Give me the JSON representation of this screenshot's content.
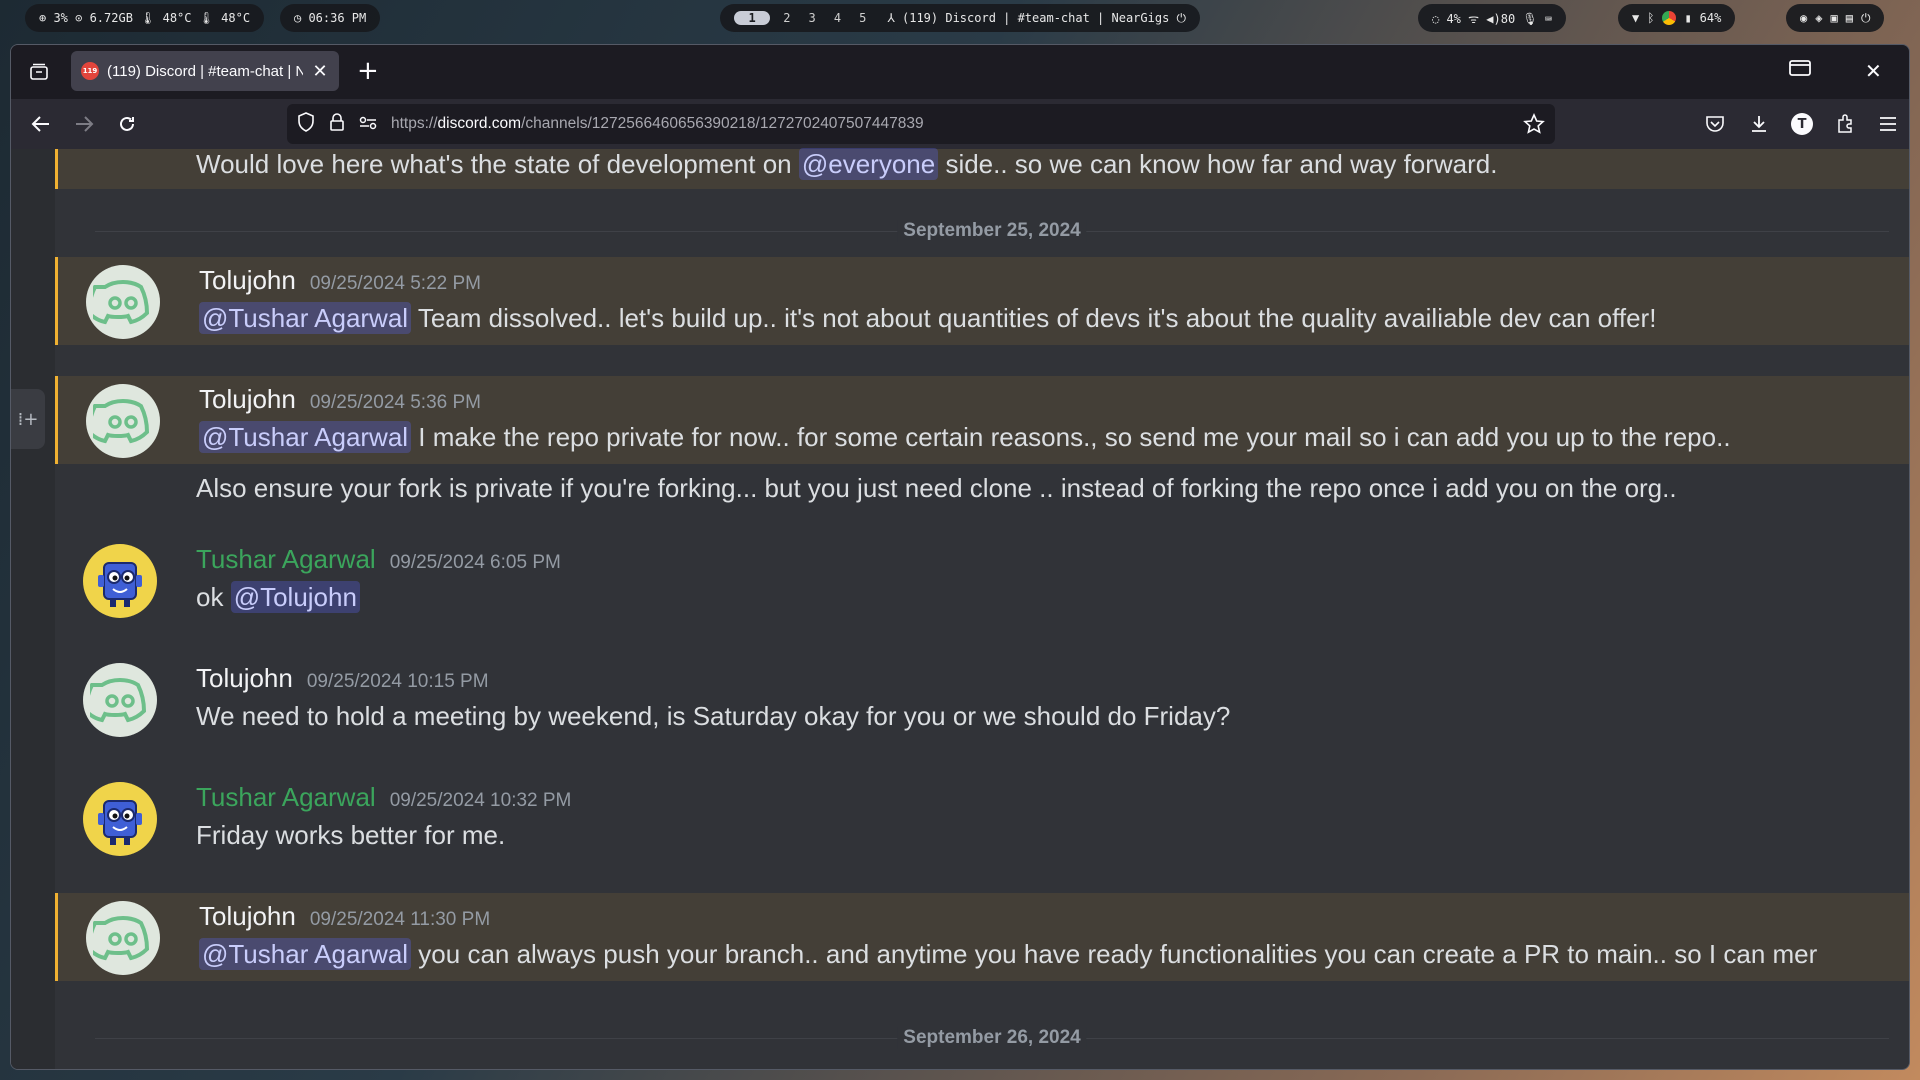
{
  "system_bar": {
    "stats": "⊕ 3%  ⊙ 6.72GB  🌡 48°C  🌡 48°C",
    "clock": "◷ 06:36 PM",
    "workspaces": [
      "1",
      "2",
      "3",
      "4",
      "5"
    ],
    "active_workspace": "1",
    "window_title": "⅄ (119) Discord | #team-chat | NearGigs ⏻",
    "net": "◌ 4%   ᯤ   ◀)80   🎙   ⌨",
    "battery": "64%"
  },
  "browser": {
    "tab_title": "(119) Discord | #team-chat | NearGigs",
    "tab_badge": "119",
    "url_prefix": "https://",
    "url_host": "discord.com",
    "url_path": "/channels/1272566460656390218/1272702407507447839"
  },
  "chat": {
    "top_line_before": "Would love here what's the state of development on ",
    "top_line_mention": "@everyone",
    "top_line_after": " side.. so we can know how far and way forward.",
    "divider1": "September 25, 2024",
    "divider2": "September 26, 2024",
    "messages": [
      {
        "author": "Tolujohn",
        "time": "09/25/2024 5:22 PM",
        "mention": "@Tushar Agarwal",
        "text": " Team dissolved.. let's build up.. it's not about quantities of devs it's about the quality availiable dev can offer!"
      },
      {
        "author": "Tolujohn",
        "time": "09/25/2024 5:36 PM",
        "mention": "@Tushar Agarwal",
        "text": " I make the repo private for now.. for some certain reasons., so send me your mail so i can add you up to the repo..",
        "text2": "Also ensure your fork is private if you're forking... but you just need clone .. instead of forking the repo once i add you on the org.."
      },
      {
        "author": "Tushar Agarwal",
        "time": "09/25/2024 6:05 PM",
        "text": "ok ",
        "mention": "@Tolujohn"
      },
      {
        "author": "Tolujohn",
        "time": "09/25/2024 10:15 PM",
        "text": "We need to hold a meeting by weekend, is Saturday okay for you or we should do Friday?"
      },
      {
        "author": "Tushar Agarwal",
        "time": "09/25/2024 10:32 PM",
        "text": "Friday works better for me."
      },
      {
        "author": "Tolujohn",
        "time": "09/25/2024 11:30 PM",
        "mention": "@Tushar Agarwal",
        "text": " you can always push your branch.. and anytime you have ready functionalities you can create a PR to main.. so I can mer"
      }
    ]
  },
  "colors": {
    "mention_highlight": "#f0b132",
    "green_author": "#3ba55c",
    "background": "#313338"
  }
}
